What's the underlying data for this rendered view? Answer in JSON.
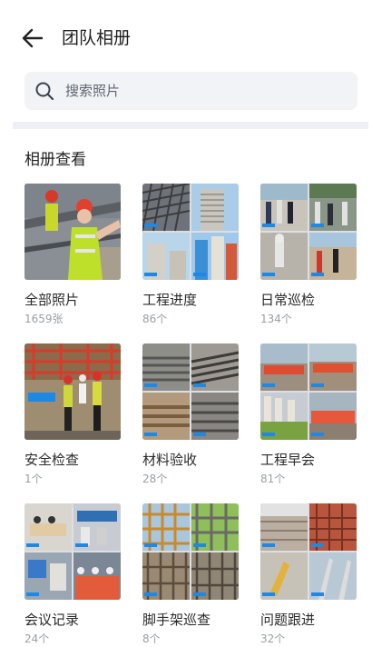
{
  "header": {
    "title": "团队相册"
  },
  "search": {
    "placeholder": "搜索照片"
  },
  "section": {
    "title": "相册查看"
  },
  "albums": [
    {
      "name": "全部照片",
      "count": "1659张"
    },
    {
      "name": "工程进度",
      "count": "86个"
    },
    {
      "name": "日常巡检",
      "count": "134个"
    },
    {
      "name": "安全检查",
      "count": "1个"
    },
    {
      "name": "材料验收",
      "count": "28个"
    },
    {
      "name": "工程早会",
      "count": "81个"
    },
    {
      "name": "会议记录",
      "count": "24个"
    },
    {
      "name": "脚手架巡查",
      "count": "8个"
    },
    {
      "name": "问题跟进",
      "count": "32个"
    }
  ],
  "colors": {
    "search_bg": "#f1f3f6",
    "divider": "#eef0f3",
    "count_text": "#9a9ea6",
    "photo_tag": "#1e88e5"
  }
}
